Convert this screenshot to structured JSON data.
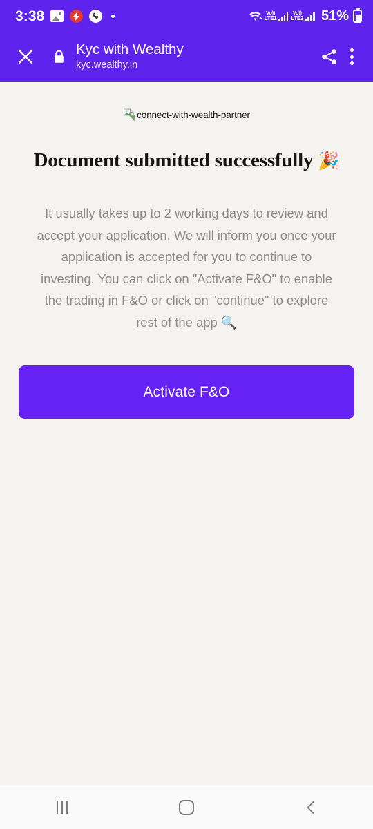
{
  "status_bar": {
    "time": "3:38",
    "left_icons": [
      "image-icon",
      "flash-alert-icon",
      "call-icon",
      "dot-indicator-icon"
    ],
    "wifi_icon": "wifi-icon",
    "sim1": {
      "volte_top": "Vo))",
      "volte_bottom": "LTE1",
      "signal_icon": "signal-bars-icon"
    },
    "sim2": {
      "volte_top": "Vo))",
      "volte_bottom": "LTE2",
      "signal_icon": "signal-bars-icon"
    },
    "battery_percent": "51%",
    "battery_icon": "battery-charging-icon"
  },
  "app_bar": {
    "close_icon": "close-icon",
    "lock_icon": "lock-icon",
    "title": "Kyc with Wealthy",
    "url": "kyc.wealthy.in",
    "share_icon": "share-icon",
    "menu_icon": "overflow-menu-icon",
    "background_color": "#5E24EE"
  },
  "main": {
    "broken_image_alt": "connect-with-wealth-partner",
    "broken_image_icon": "broken-image-icon",
    "heading": "Document submitted successfully",
    "heading_emoji": "🎉",
    "body": "It usually takes up to 2 working days to review and accept your application. We will inform you once your application is accepted for you to continue to investing. You can click on \"Activate F&O\" to enable the trading in F&O or click on \"continue\" to explore rest of the app 🔍",
    "cta_label": "Activate F&O",
    "cta_color": "#6622F5",
    "background_color": "#F5F3EF"
  },
  "nav_bar": {
    "recents_icon": "recents-icon",
    "home_icon": "home-icon",
    "back_icon": "back-icon"
  }
}
